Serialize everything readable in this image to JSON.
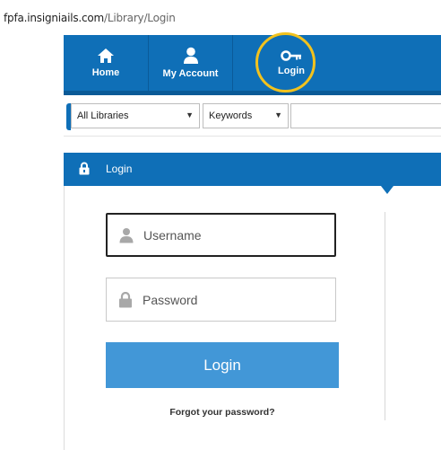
{
  "browser": {
    "url_domain": "fpfa.insigniails.com",
    "url_path": "/Library/Login"
  },
  "nav": {
    "items": [
      {
        "label": "Home",
        "icon": "home-icon"
      },
      {
        "label": "My Account",
        "icon": "user-icon"
      },
      {
        "label": "Login",
        "icon": "key-icon"
      }
    ],
    "highlight_color": "#f2c21d"
  },
  "search": {
    "library_select": "All Libraries",
    "field_select": "Keywords",
    "query": ""
  },
  "login_panel": {
    "title": "Login",
    "username_placeholder": "Username",
    "password_placeholder": "Password",
    "submit_label": "Login",
    "forgot_label": "Forgot your password?"
  },
  "colors": {
    "primary": "#0f6fb7",
    "button": "#4297d7"
  }
}
